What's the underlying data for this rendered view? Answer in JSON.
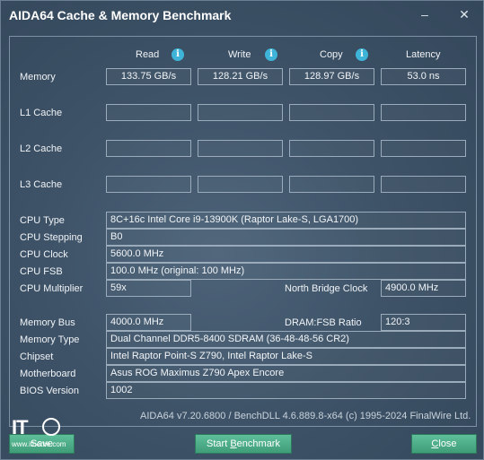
{
  "window": {
    "title": "AIDA64 Cache & Memory Benchmark",
    "minimize": "–",
    "close": "✕"
  },
  "columns": {
    "read": "Read",
    "write": "Write",
    "copy": "Copy",
    "latency": "Latency"
  },
  "rows": {
    "memory": {
      "label": "Memory",
      "read": "133.75 GB/s",
      "write": "128.21 GB/s",
      "copy": "128.97 GB/s",
      "latency": "53.0 ns"
    },
    "l1": {
      "label": "L1 Cache",
      "read": "",
      "write": "",
      "copy": "",
      "latency": ""
    },
    "l2": {
      "label": "L2 Cache",
      "read": "",
      "write": "",
      "copy": "",
      "latency": ""
    },
    "l3": {
      "label": "L3 Cache",
      "read": "",
      "write": "",
      "copy": "",
      "latency": ""
    }
  },
  "cpu": {
    "type_label": "CPU Type",
    "type": "8C+16c Intel Core i9-13900K  (Raptor Lake-S, LGA1700)",
    "stepping_label": "CPU Stepping",
    "stepping": "B0",
    "clock_label": "CPU Clock",
    "clock": "5600.0 MHz",
    "fsb_label": "CPU FSB",
    "fsb": "100.0 MHz  (original: 100 MHz)",
    "multiplier_label": "CPU Multiplier",
    "multiplier": "59x",
    "nb_clock_label": "North Bridge Clock",
    "nb_clock": "4900.0 MHz"
  },
  "memory_info": {
    "bus_label": "Memory Bus",
    "bus": "4000.0 MHz",
    "ratio_label": "DRAM:FSB Ratio",
    "ratio": "120:3",
    "type_label": "Memory Type",
    "type": "Dual Channel DDR5-8400 SDRAM  (36-48-48-56  CR2)",
    "chipset_label": "Chipset",
    "chipset": "Intel Raptor Point-S Z790, Intel Raptor Lake-S",
    "motherboard_label": "Motherboard",
    "motherboard": "Asus ROG Maximus Z790 Apex Encore",
    "bios_label": "BIOS Version",
    "bios": "1002"
  },
  "footer": "AIDA64 v7.20.6800 / BenchDLL 4.6.889.8-x64  (c) 1995-2024 FinalWire Ltd.",
  "buttons": {
    "save": "Save",
    "start_prefix": "Start ",
    "start_underlined": "B",
    "start_suffix": "enchmark",
    "close_underlined": "C",
    "close_suffix": "lose"
  },
  "watermark": {
    "brand": "IT",
    "site": "www.ithome.com"
  },
  "colors": {
    "accent_button": "#4aab86",
    "info_icon": "#3fb4d9"
  }
}
